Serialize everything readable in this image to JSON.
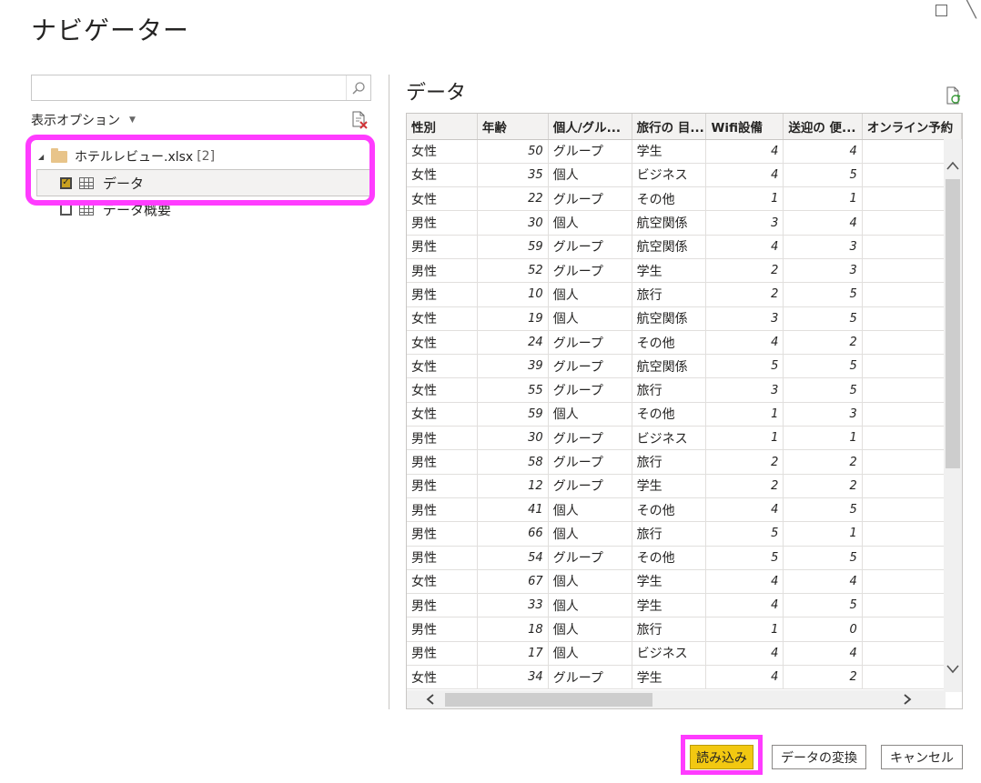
{
  "window": {
    "title": "ナビゲーター",
    "maximize_glyph": "",
    "close_glyph": "〉"
  },
  "search": {
    "value": "",
    "placeholder": ""
  },
  "display_options": {
    "label": "表示オプション",
    "caret": "▼"
  },
  "tree": {
    "root": {
      "label": "ホテルレビュー.xlsx",
      "count": "[2]",
      "expander": "◢"
    },
    "items": [
      {
        "label": "データ",
        "checked": true
      },
      {
        "label": "データ概要",
        "checked": false
      }
    ]
  },
  "preview": {
    "title": "データ",
    "columns": [
      "性別",
      "年齢",
      "個人/グル...",
      "旅行の 目...",
      "Wifi設備",
      "送迎の 便...",
      "オンライン予約"
    ],
    "rows": [
      [
        "女性",
        "50",
        "グループ",
        "学生",
        "4",
        "4",
        ""
      ],
      [
        "女性",
        "35",
        "個人",
        "ビジネス",
        "4",
        "5",
        ""
      ],
      [
        "女性",
        "22",
        "グループ",
        "その他",
        "1",
        "1",
        ""
      ],
      [
        "男性",
        "30",
        "個人",
        "航空関係",
        "3",
        "4",
        ""
      ],
      [
        "男性",
        "59",
        "グループ",
        "航空関係",
        "4",
        "3",
        ""
      ],
      [
        "男性",
        "52",
        "グループ",
        "学生",
        "2",
        "3",
        ""
      ],
      [
        "男性",
        "10",
        "個人",
        "旅行",
        "2",
        "5",
        ""
      ],
      [
        "女性",
        "19",
        "個人",
        "航空関係",
        "3",
        "5",
        ""
      ],
      [
        "女性",
        "24",
        "グループ",
        "その他",
        "4",
        "2",
        ""
      ],
      [
        "女性",
        "39",
        "グループ",
        "航空関係",
        "5",
        "5",
        ""
      ],
      [
        "女性",
        "55",
        "グループ",
        "旅行",
        "3",
        "5",
        ""
      ],
      [
        "女性",
        "59",
        "個人",
        "その他",
        "1",
        "3",
        ""
      ],
      [
        "男性",
        "30",
        "グループ",
        "ビジネス",
        "1",
        "1",
        ""
      ],
      [
        "男性",
        "58",
        "グループ",
        "旅行",
        "2",
        "2",
        ""
      ],
      [
        "男性",
        "12",
        "グループ",
        "学生",
        "2",
        "2",
        ""
      ],
      [
        "男性",
        "41",
        "個人",
        "その他",
        "4",
        "5",
        ""
      ],
      [
        "男性",
        "66",
        "個人",
        "旅行",
        "5",
        "1",
        ""
      ],
      [
        "男性",
        "54",
        "グループ",
        "その他",
        "5",
        "5",
        ""
      ],
      [
        "女性",
        "67",
        "個人",
        "学生",
        "4",
        "4",
        ""
      ],
      [
        "男性",
        "33",
        "個人",
        "学生",
        "4",
        "5",
        ""
      ],
      [
        "男性",
        "18",
        "個人",
        "旅行",
        "1",
        "0",
        ""
      ],
      [
        "男性",
        "17",
        "個人",
        "ビジネス",
        "4",
        "4",
        ""
      ],
      [
        "女性",
        "34",
        "グループ",
        "学生",
        "4",
        "2",
        ""
      ]
    ]
  },
  "buttons": {
    "load": "読み込み",
    "transform": "データの変換",
    "cancel": "キャンセル"
  },
  "colors": {
    "accent_yellow": "#f2c811",
    "highlight_magenta": "#ff3cff",
    "folder": "#e8c48a"
  },
  "icons": [
    "search-icon",
    "clear-selection-icon",
    "folder-icon",
    "table-icon",
    "refresh-icon",
    "scroll-up-icon",
    "scroll-down-icon",
    "scroll-left-icon",
    "scroll-right-icon"
  ]
}
